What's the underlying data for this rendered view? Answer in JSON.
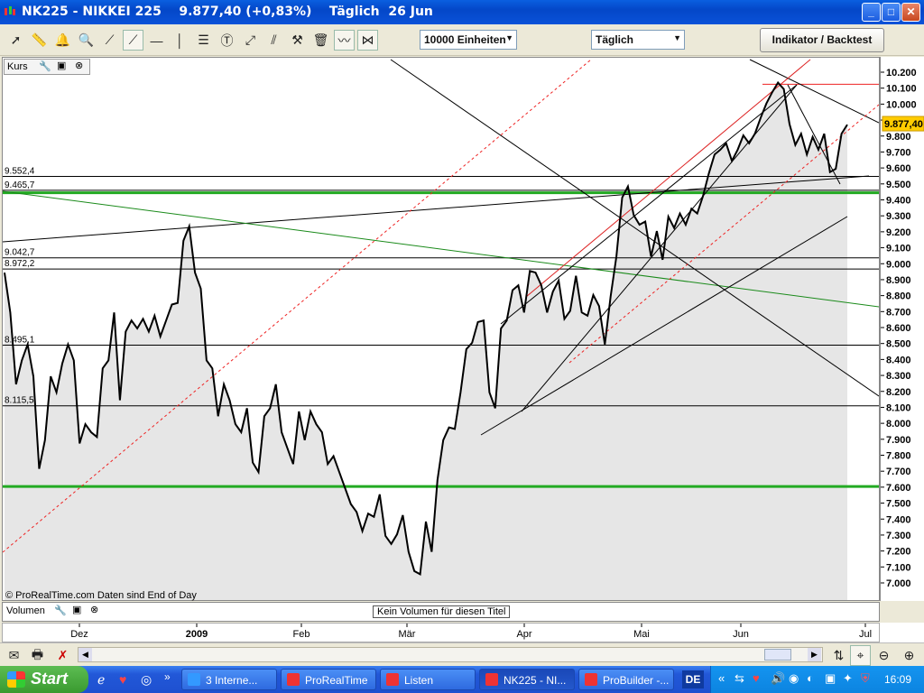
{
  "window": {
    "title": "NK225 - NIKKEI 225    9.877,40 (+0,83%)    Täglich  26 Jun",
    "min_label": "_",
    "max_label": "□",
    "close_label": "✕"
  },
  "toolbar": {
    "tools": [
      "pointer-icon",
      "ruler-icon",
      "bell-icon",
      "zoom-icon",
      "line-icon",
      "trendline-icon",
      "horizontal-line-icon",
      "vertical-line-icon",
      "fibonacci-icon",
      "text-icon",
      "fan-icon",
      "channel-icon",
      "tools-icon",
      "trash-icon",
      "indicator-icon",
      "pattern-icon"
    ],
    "units_dropdown": "10000 Einheiten",
    "period_dropdown": "Täglich",
    "indicator_button": "Indikator / Backtest"
  },
  "chart": {
    "panel_label": "Kurs",
    "watermark": "© ProRealTime.com  Daten sind End of Day",
    "current_price": "9.877,40",
    "level_labels": [
      "9.552,4",
      "9.465,7",
      "9.042,7",
      "8.972,2",
      "8.495,1",
      "8.115,5"
    ],
    "colors": {
      "price_line": "#000000",
      "fill": "#e6e6e6",
      "support": "#22aa22",
      "channel": "#ee2222",
      "badge": "#ffcc00"
    }
  },
  "chart_data": {
    "type": "line",
    "ylim": [
      6900,
      10300
    ],
    "yticks": [
      "10.200",
      "10.100",
      "10.000",
      "9.900",
      "9.800",
      "9.700",
      "9.600",
      "9.500",
      "9.400",
      "9.300",
      "9.200",
      "9.100",
      "9.000",
      "8.900",
      "8.800",
      "8.700",
      "8.600",
      "8.500",
      "8.400",
      "8.300",
      "8.200",
      "8.100",
      "8.000",
      "7.900",
      "7.800",
      "7.700",
      "7.600",
      "7.500",
      "7.400",
      "7.300",
      "7.200",
      "7.100",
      "7.000"
    ],
    "xlabels": [
      "Dez",
      "2009",
      "Feb",
      "Mär",
      "Apr",
      "Mai",
      "Jun",
      "Jul"
    ],
    "horizontal_levels": [
      9552.4,
      9465.7,
      9042.7,
      8972.2,
      8495.1,
      8115.5
    ],
    "green_levels": [
      9450,
      7610
    ],
    "red_level": 10130,
    "values": [
      8950,
      8700,
      8250,
      8400,
      8500,
      8300,
      7720,
      7900,
      8300,
      8200,
      8380,
      8500,
      8400,
      7880,
      8000,
      7950,
      7920,
      8350,
      8400,
      8700,
      8150,
      8580,
      8650,
      8600,
      8660,
      8580,
      8680,
      8550,
      8650,
      8750,
      8760,
      9150,
      9240,
      8950,
      8850,
      8400,
      8350,
      8050,
      8250,
      8150,
      8000,
      7950,
      8100,
      7760,
      7700,
      8050,
      8100,
      8250,
      7950,
      7850,
      7750,
      8080,
      7900,
      8080,
      8000,
      7950,
      7750,
      7800,
      7700,
      7600,
      7500,
      7450,
      7330,
      7440,
      7420,
      7560,
      7300,
      7250,
      7310,
      7430,
      7200,
      7080,
      7060,
      7390,
      7200,
      7650,
      7900,
      7980,
      7970,
      8200,
      8470,
      8510,
      8640,
      8650,
      8200,
      8100,
      8600,
      8650,
      8840,
      8870,
      8700,
      8960,
      8950,
      8870,
      8700,
      8830,
      8900,
      8660,
      8710,
      8930,
      8700,
      8680,
      8810,
      8740,
      8500,
      8800,
      9050,
      9420,
      9490,
      9310,
      9250,
      9270,
      9050,
      9210,
      9030,
      9300,
      9230,
      9320,
      9250,
      9350,
      9320,
      9430,
      9570,
      9690,
      9720,
      9760,
      9650,
      9720,
      9810,
      9760,
      9820,
      9920,
      10010,
      10080,
      10140,
      10100,
      9880,
      9750,
      9820,
      9690,
      9800,
      9720,
      9820,
      9580,
      9600,
      9820,
      9877
    ],
    "current": 9877.4
  },
  "volume": {
    "panel_label": "Volumen",
    "message": "Kein Volumen für diesen Titel"
  },
  "taskbar": {
    "start_label": "Start",
    "tasks": [
      "3 Interne...",
      "ProRealTime",
      "Listen",
      "NK225 - NI...",
      "ProBuilder -..."
    ],
    "lang": "DE",
    "clock": "16:09"
  }
}
